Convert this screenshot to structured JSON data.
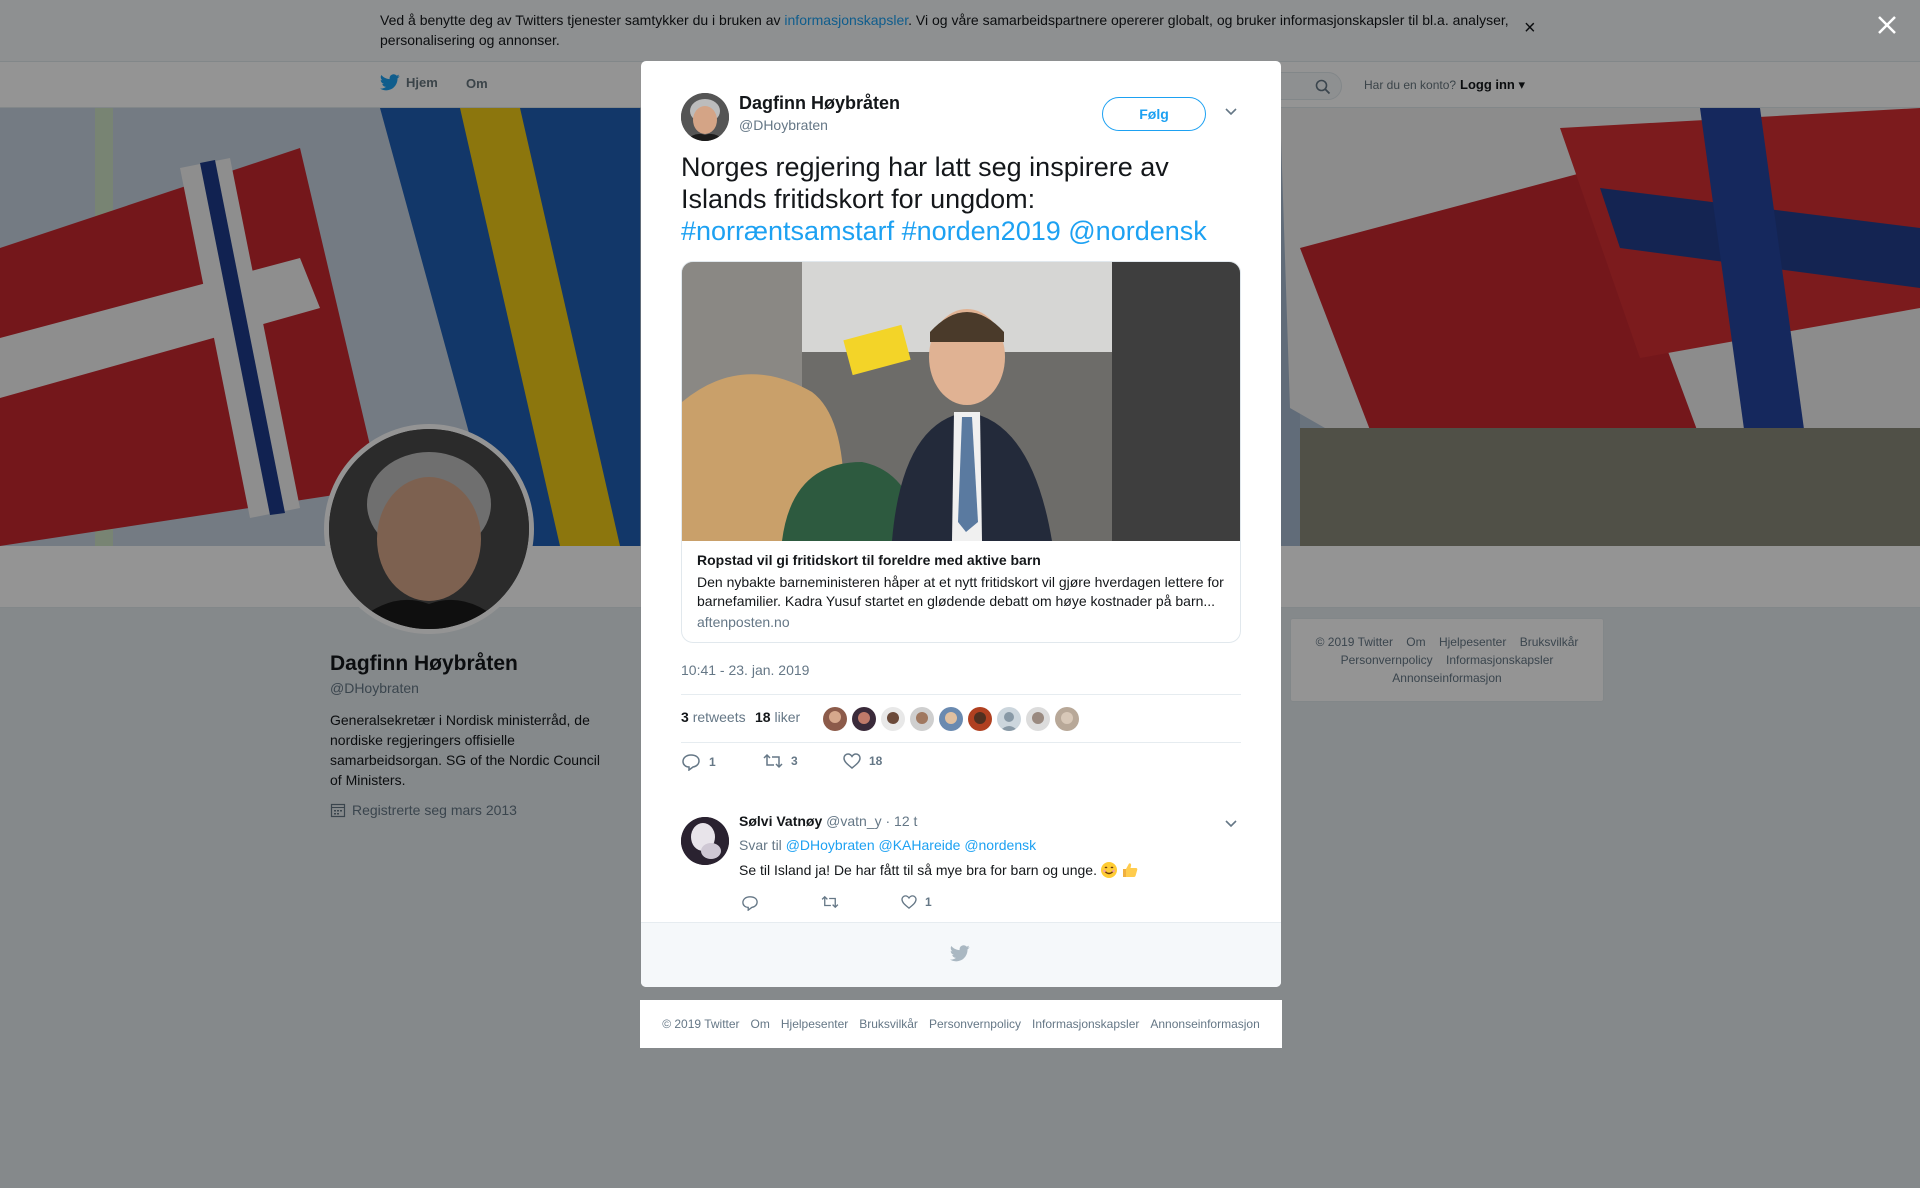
{
  "cookie": {
    "text_before": "Ved å benytte deg av Twitters tjenester samtykker du i bruken av ",
    "link": "informasjonskapsler",
    "text_after": ". Vi og våre samarbeidspartnere opererer globalt, og bruker informasjonskapsler til bl.a. analyser, personalisering og annonser.",
    "close": "×"
  },
  "nav": {
    "home": "Hjem",
    "about": "Om",
    "login_question": "Har du en konto?",
    "login": "Logg inn"
  },
  "profile": {
    "name": "Dagfinn Høybråten",
    "handle": "@DHoybraten",
    "bio": "Generalsekretær i Nordisk ministerråd, de nordiske regjeringers offisielle samarbeidsorgan. SG of the Nordic Council of Ministers.",
    "joined": "Registrerte seg mars 2013"
  },
  "side_footer": {
    "items": [
      "© 2019 Twitter",
      "Om",
      "Hjelpesenter",
      "Bruksvilkår",
      "Personvernpolicy",
      "Informasjonskapsler",
      "Annonseinformasjon"
    ]
  },
  "tweet": {
    "author_name": "Dagfinn Høybråten",
    "author_handle": "@DHoybraten",
    "follow_label": "Følg",
    "text_line1": "Norges regjering har latt seg inspirere av",
    "text_line2": "Islands fritidskort for ungdom:",
    "hashtag1": "#norræntsamstarf",
    "hashtag2": "#norden2019",
    "mention": "@nordensk",
    "card": {
      "title": "Ropstad vil gi fritidskort til foreldre med aktive barn",
      "description": "Den nybakte barneministeren håper at et nytt fritidskort vil gjøre hverdagen lettere for barnefamilier. Kadra Yusuf startet en glødende debatt om høye kostnader på barn...",
      "domain": "aftenposten.no"
    },
    "timestamp": "10:41 - 23. jan. 2019",
    "retweets_count": "3",
    "retweets_label": "retweets",
    "likes_count": "18",
    "likes_label": "liker",
    "replies": "1",
    "retweets": "3",
    "likes": "18"
  },
  "reply": {
    "name": "Sølvi Vatnøy",
    "handle": "@vatn_y",
    "time": "· 12 t",
    "reply_to_label": "Svar til",
    "reply_to_1": "@DHoybraten",
    "reply_to_2": "@KAHareide",
    "reply_to_3": "@nordensk",
    "text": "Se til Island ja! De har fått til så mye bra for barn og unge.",
    "likes": "1"
  },
  "bottom_footer": {
    "items": [
      "© 2019 Twitter",
      "Om",
      "Hjelpesenter",
      "Bruksvilkår",
      "Personvernpolicy",
      "Informasjonskapsler",
      "Annonseinformasjon"
    ]
  },
  "colors": {
    "accent": "#1da1f2",
    "muted": "#657786",
    "text": "#14171a"
  },
  "icons": [
    "twitter-bird-icon",
    "search-icon",
    "close-icon",
    "chevron-down-icon",
    "reply-icon",
    "retweet-icon",
    "heart-icon",
    "calendar-icon"
  ]
}
